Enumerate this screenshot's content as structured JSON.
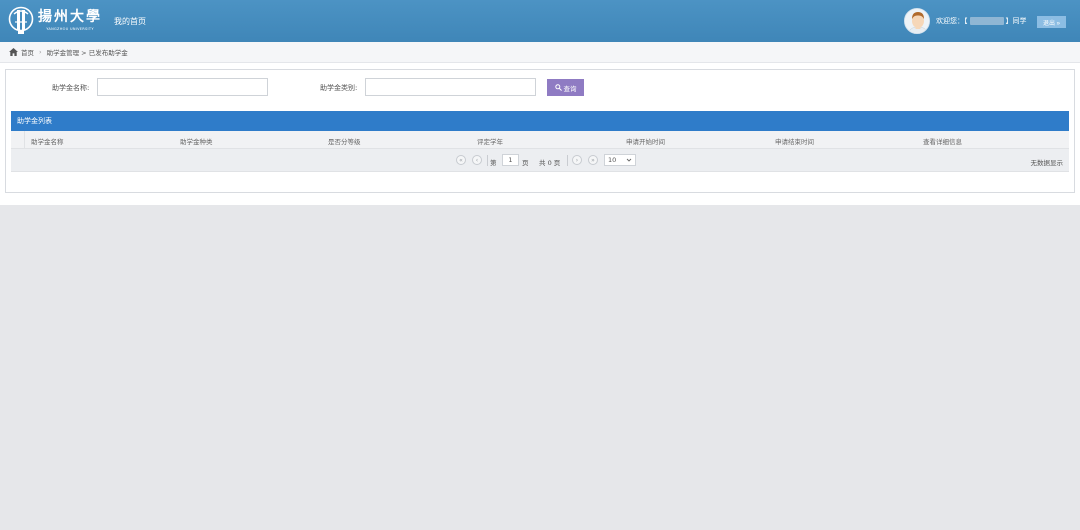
{
  "header": {
    "logo_cn": "揚州大學",
    "logo_en": "YANGZHOU UNIVERSITY",
    "nav_home": "我的首页",
    "welcome_prefix": "欢迎您：【",
    "welcome_suffix": "】同学",
    "logout_label": "退出 »"
  },
  "breadcrumb": {
    "home": "首页",
    "path": "助学金管理 > 已发布助学金"
  },
  "search": {
    "name_label": "助学金名称:",
    "name_value": "",
    "type_label": "助学金类别:",
    "type_value": "",
    "query_label": "查询"
  },
  "list": {
    "title": "助学金列表",
    "columns": [
      "助学金名称",
      "助学金种类",
      "是否分等级",
      "评定学年",
      "申请开始时间",
      "申请结束时间",
      "查看详细信息"
    ]
  },
  "pager": {
    "page_prefix": "第",
    "page_value": "1",
    "page_suffix": "页",
    "total": "共 0 页",
    "page_size": "10",
    "status": "无数据显示"
  },
  "colors": {
    "header_bg": "#4a90c0",
    "list_header_bg": "#2f7cc9",
    "query_btn_bg": "#8f7bc3",
    "logout_btn_bg": "#8cbde3"
  }
}
